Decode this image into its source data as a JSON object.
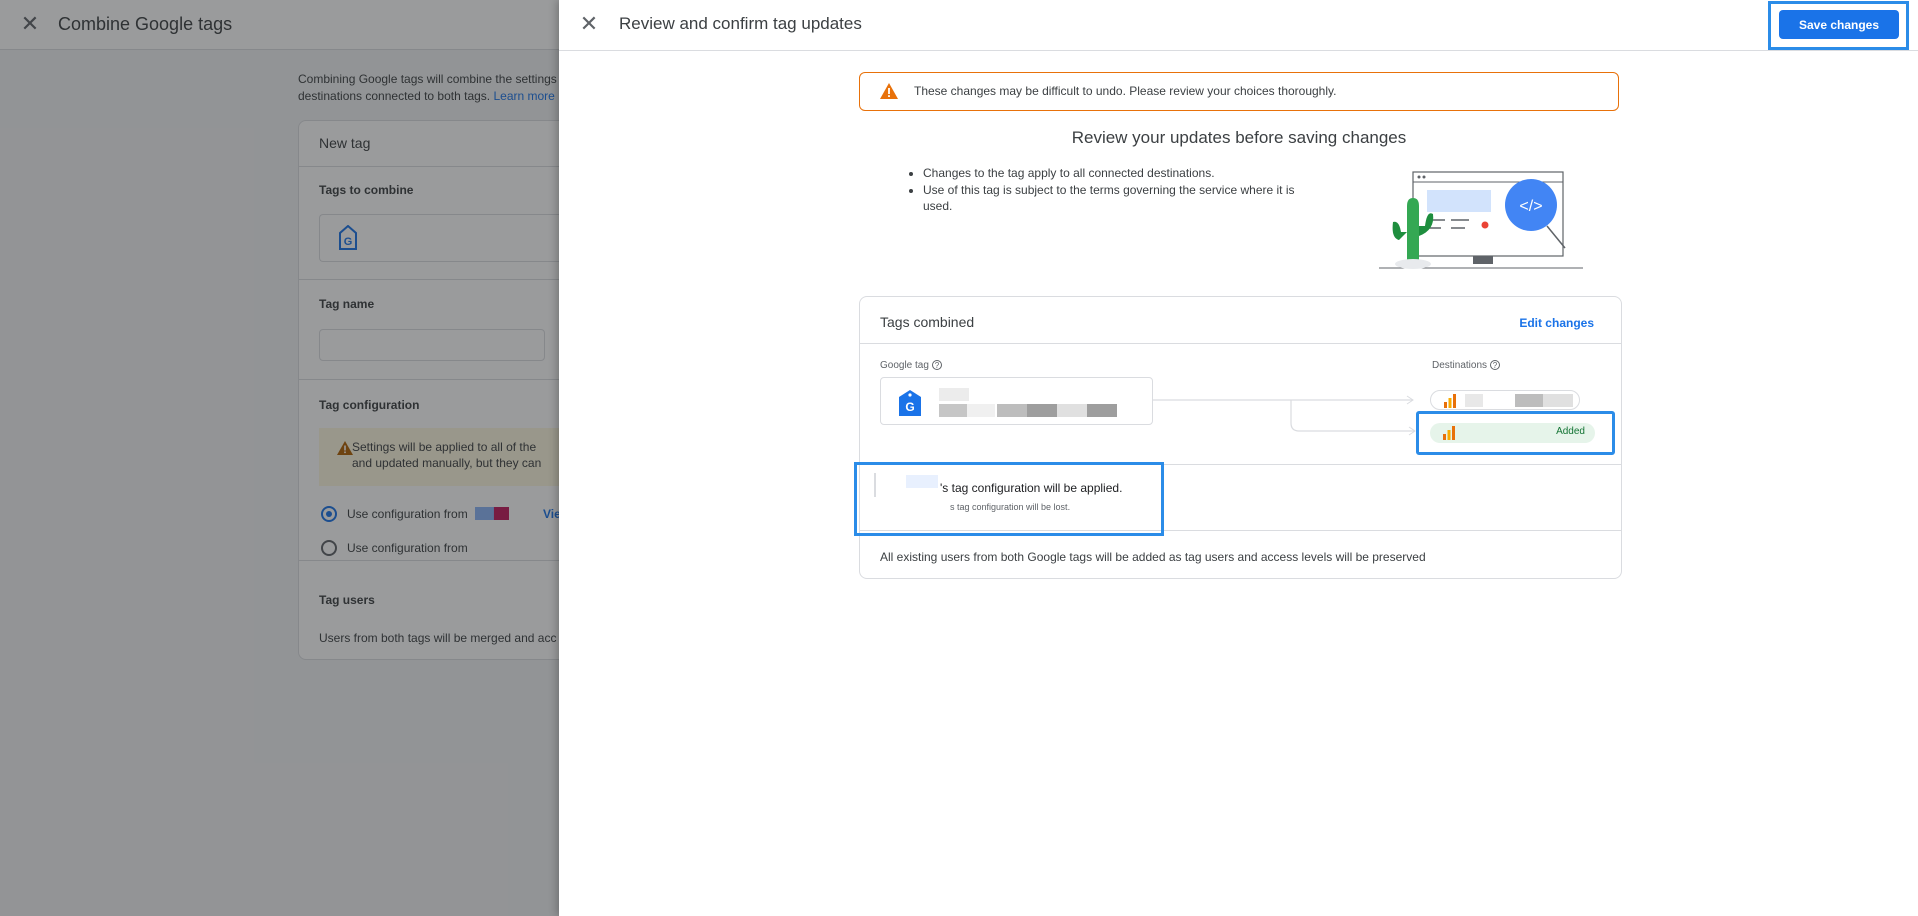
{
  "background": {
    "title": "Combine Google tags",
    "intro_line1": "Combining Google tags will combine the settings",
    "intro_line2": "destinations connected to both tags.",
    "learn_more": "Learn more",
    "new_tag": "New tag",
    "tags_to_combine": "Tags to combine",
    "tag_name": "Tag name",
    "tag_configuration": "Tag configuration",
    "warning_line1": "Settings will be applied to all of the",
    "warning_line2": "and updated manually, but they can",
    "radio_option_1": "Use configuration from",
    "radio_option_2": "Use configuration from",
    "view_link": "Vie",
    "tag_users": "Tag users",
    "tag_users_text": "Users from both tags will be merged and acc"
  },
  "panel": {
    "title": "Review and confirm tag updates",
    "save_label": "Save changes",
    "banner_text": "These changes may be difficult to undo. Please review your choices thoroughly.",
    "review_title": "Review your updates before saving changes",
    "bullets": [
      "Changes to the tag apply to all connected destinations.",
      "Use of this tag is subject to the terms governing the service where it is used."
    ],
    "card": {
      "title": "Tags combined",
      "edit_label": "Edit changes",
      "google_tag_label": "Google tag",
      "destinations_label": "Destinations",
      "added_label": "Added",
      "applied_text": "'s tag configuration will be applied.",
      "lost_text": "s tag configuration will be lost.",
      "footer_text": "All existing users from both Google tags will be added as tag users and access levels will be preserved"
    }
  },
  "colors": {
    "accent": "#1a73e8",
    "highlight": "#2b8ce8",
    "warning": "#e8710a",
    "added_bg": "#e6f4ea"
  }
}
